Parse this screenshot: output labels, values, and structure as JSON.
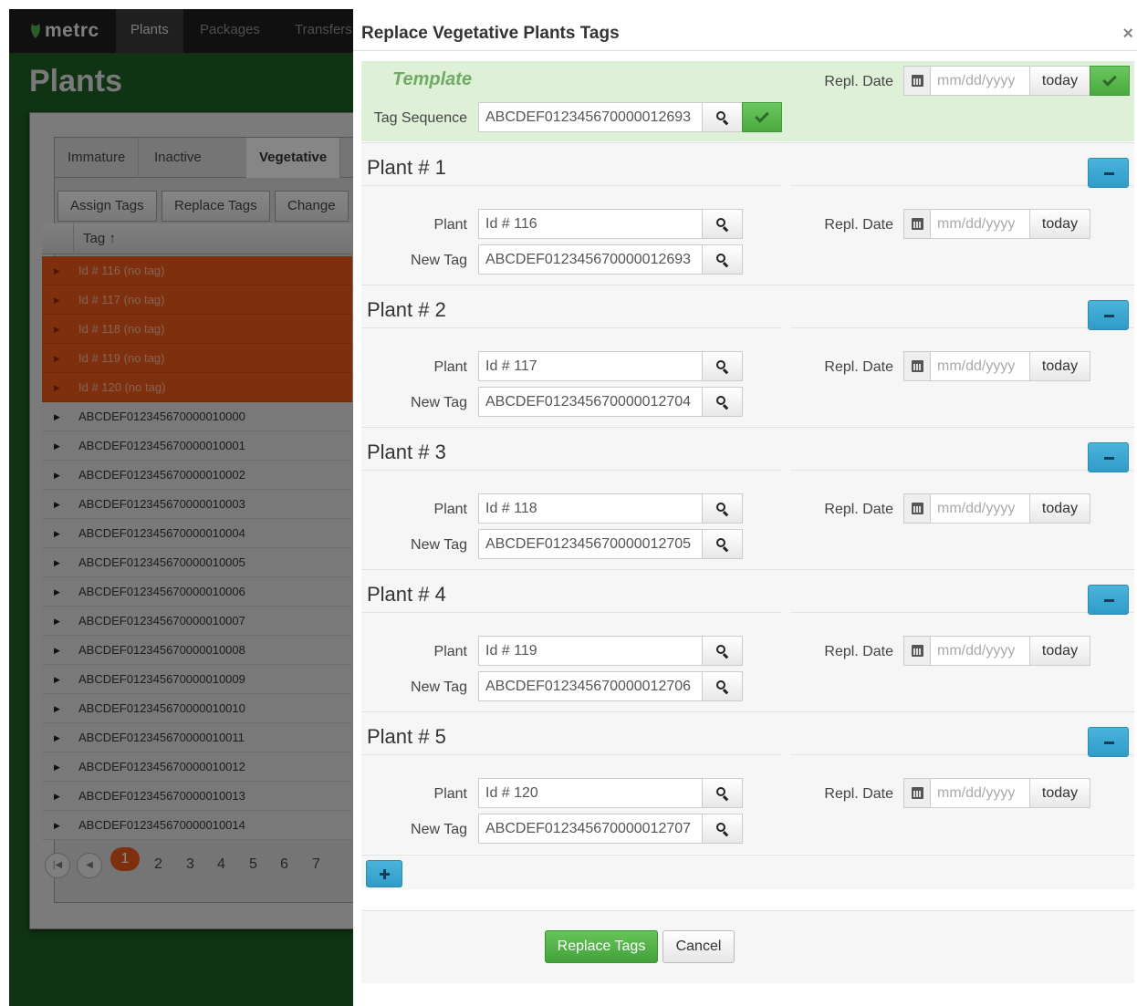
{
  "app": {
    "logo": "metrc",
    "nav": [
      "Plants",
      "Packages",
      "Transfers"
    ],
    "page_title": "Plants",
    "tabs": [
      "Immature",
      "Inactive",
      "Vegetative"
    ],
    "actions": [
      "Assign Tags",
      "Replace Tags",
      "Change"
    ],
    "grid_header": "Tag ↑",
    "rows": [
      {
        "tag": "Id # 116 (no tag)",
        "no_tag": true
      },
      {
        "tag": "Id # 117 (no tag)",
        "no_tag": true
      },
      {
        "tag": "Id # 118 (no tag)",
        "no_tag": true
      },
      {
        "tag": "Id # 119 (no tag)",
        "no_tag": true
      },
      {
        "tag": "Id # 120 (no tag)",
        "no_tag": true
      },
      {
        "tag": "ABCDEF012345670000010000",
        "no_tag": false
      },
      {
        "tag": "ABCDEF012345670000010001",
        "no_tag": false
      },
      {
        "tag": "ABCDEF012345670000010002",
        "no_tag": false
      },
      {
        "tag": "ABCDEF012345670000010003",
        "no_tag": false
      },
      {
        "tag": "ABCDEF012345670000010004",
        "no_tag": false
      },
      {
        "tag": "ABCDEF012345670000010005",
        "no_tag": false
      },
      {
        "tag": "ABCDEF012345670000010006",
        "no_tag": false
      },
      {
        "tag": "ABCDEF012345670000010007",
        "no_tag": false
      },
      {
        "tag": "ABCDEF012345670000010008",
        "no_tag": false
      },
      {
        "tag": "ABCDEF012345670000010009",
        "no_tag": false
      },
      {
        "tag": "ABCDEF012345670000010010",
        "no_tag": false
      },
      {
        "tag": "ABCDEF012345670000010011",
        "no_tag": false
      },
      {
        "tag": "ABCDEF012345670000010012",
        "no_tag": false
      },
      {
        "tag": "ABCDEF012345670000010013",
        "no_tag": false
      },
      {
        "tag": "ABCDEF012345670000010014",
        "no_tag": false
      }
    ],
    "pager": {
      "current": "1",
      "pages": [
        "2",
        "3",
        "4",
        "5",
        "6",
        "7"
      ]
    }
  },
  "modal": {
    "title": "Replace Vegetative Plants Tags",
    "close": "×",
    "template": {
      "title": "Template",
      "repl_date_label": "Repl. Date",
      "repl_date_placeholder": "mm/dd/yyyy",
      "today_label": "today",
      "tag_sequence_label": "Tag Sequence",
      "tag_sequence_value": "ABCDEF012345670000012693"
    },
    "labels": {
      "plant": "Plant",
      "new_tag": "New Tag",
      "repl_date": "Repl. Date",
      "date_placeholder": "mm/dd/yyyy",
      "today": "today"
    },
    "plants": [
      {
        "title": "Plant # 1",
        "plant": "Id # 116",
        "new_tag": "ABCDEF012345670000012693"
      },
      {
        "title": "Plant # 2",
        "plant": "Id # 117",
        "new_tag": "ABCDEF012345670000012704"
      },
      {
        "title": "Plant # 3",
        "plant": "Id # 118",
        "new_tag": "ABCDEF012345670000012705"
      },
      {
        "title": "Plant # 4",
        "plant": "Id # 119",
        "new_tag": "ABCDEF012345670000012706"
      },
      {
        "title": "Plant # 5",
        "plant": "Id # 120",
        "new_tag": "ABCDEF012345670000012707"
      }
    ],
    "replace_button": "Replace Tags",
    "cancel_button": "Cancel"
  },
  "colors": {
    "accent_blue": "#2f9cc8",
    "success_green": "#49a93e",
    "no_tag_orange": "#e5581b",
    "template_bg": "#dff0d8"
  },
  "icons": [
    "leaf-icon",
    "search-icon",
    "calendar-icon",
    "check-icon",
    "minus-icon",
    "plus-icon",
    "close-icon",
    "expand-arrow-icon",
    "first-page-icon",
    "prev-page-icon"
  ]
}
